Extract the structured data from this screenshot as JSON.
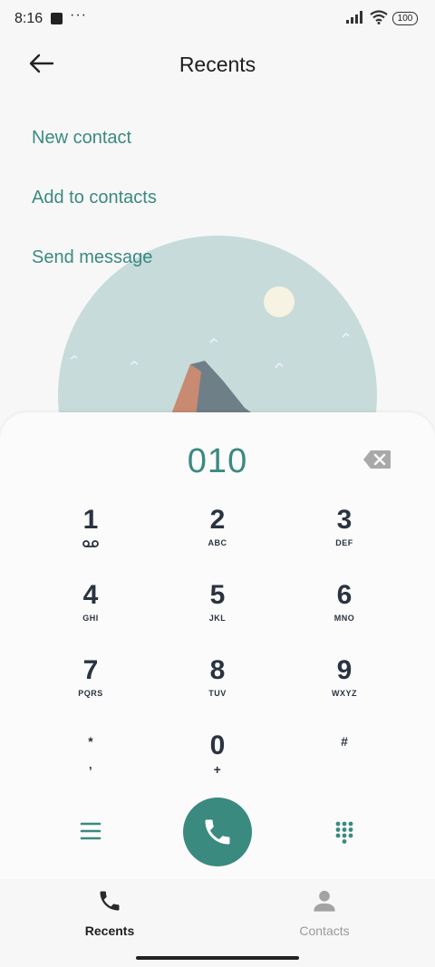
{
  "status_bar": {
    "time": "8:16",
    "dots": "···",
    "battery": "100"
  },
  "header": {
    "title": "Recents",
    "back_icon": "arrow-left-icon"
  },
  "options": {
    "new_contact": "New contact",
    "add_to_contacts": "Add to contacts",
    "send_message": "Send message"
  },
  "dialer": {
    "dialed_number": "010",
    "backspace_icon": "backspace-icon",
    "keys": [
      {
        "digit": "1",
        "letters": ""
      },
      {
        "digit": "2",
        "letters": "ABC"
      },
      {
        "digit": "3",
        "letters": "DEF"
      },
      {
        "digit": "4",
        "letters": "GHI"
      },
      {
        "digit": "5",
        "letters": "JKL"
      },
      {
        "digit": "6",
        "letters": "MNO"
      },
      {
        "digit": "7",
        "letters": "PQRS"
      },
      {
        "digit": "8",
        "letters": "TUV"
      },
      {
        "digit": "9",
        "letters": "WXYZ"
      },
      {
        "digit": "*",
        "letters": ","
      },
      {
        "digit": "0",
        "letters": "+"
      },
      {
        "digit": "#",
        "letters": ""
      }
    ],
    "voicemail_icon": "voicemail-icon",
    "menu_icon": "menu-icon",
    "call_icon": "phone-icon",
    "keypad_icon": "keypad-icon"
  },
  "bottom_nav": {
    "recents_label": "Recents",
    "contacts_label": "Contacts"
  },
  "colors": {
    "accent": "#3a8a80",
    "key_text": "#2a3340",
    "illustration_bg": "#c7dbda"
  }
}
